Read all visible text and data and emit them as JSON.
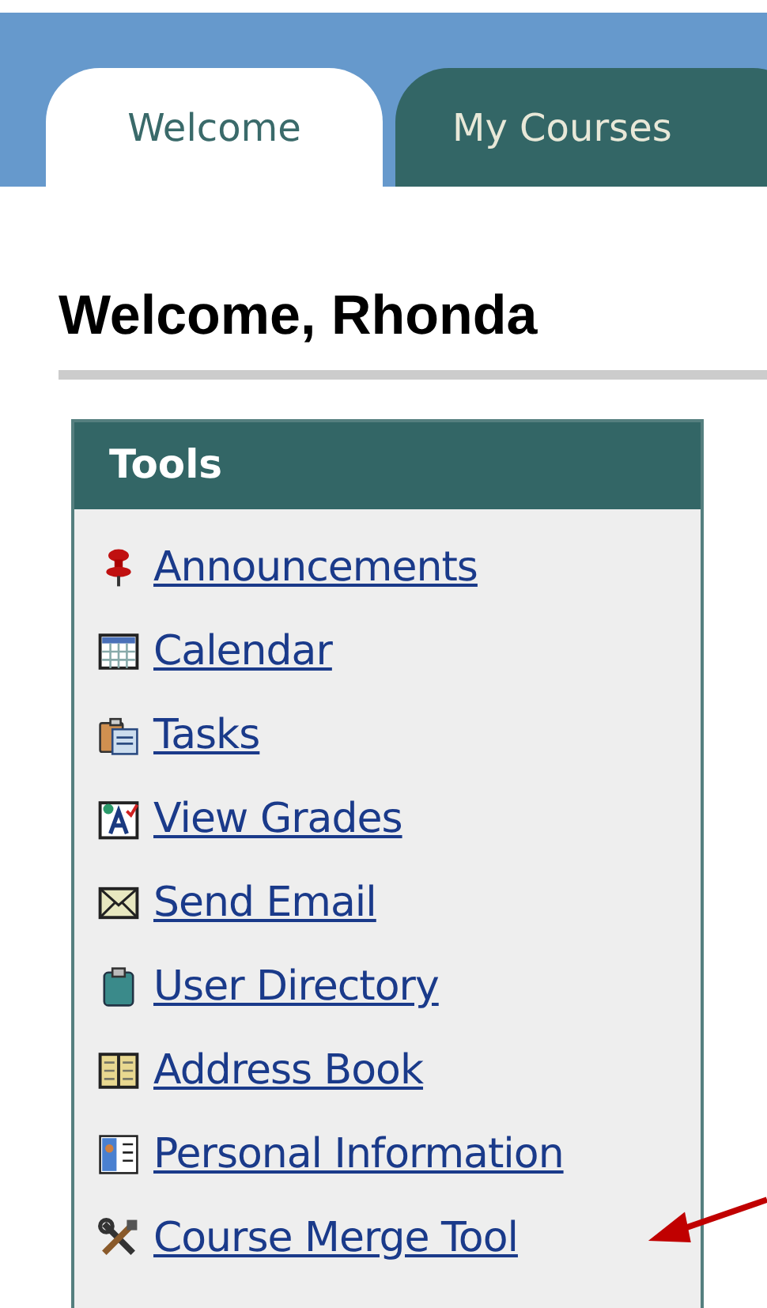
{
  "tabs": [
    {
      "label": "Welcome",
      "selected": true
    },
    {
      "label": "My Courses",
      "selected": false
    }
  ],
  "heading": "Welcome, Rhonda",
  "tools": {
    "title": "Tools",
    "items": [
      {
        "label": "Announcements",
        "kind": "pin"
      },
      {
        "label": "Calendar",
        "kind": "calendar"
      },
      {
        "label": "Tasks",
        "kind": "tasks"
      },
      {
        "label": "View Grades",
        "kind": "grades"
      },
      {
        "label": "Send Email",
        "kind": "envelope"
      },
      {
        "label": "User Directory",
        "kind": "clipboard"
      },
      {
        "label": "Address Book",
        "kind": "book"
      },
      {
        "label": "Personal Information",
        "kind": "card"
      },
      {
        "label": "Course Merge Tool",
        "kind": "tools"
      }
    ]
  }
}
